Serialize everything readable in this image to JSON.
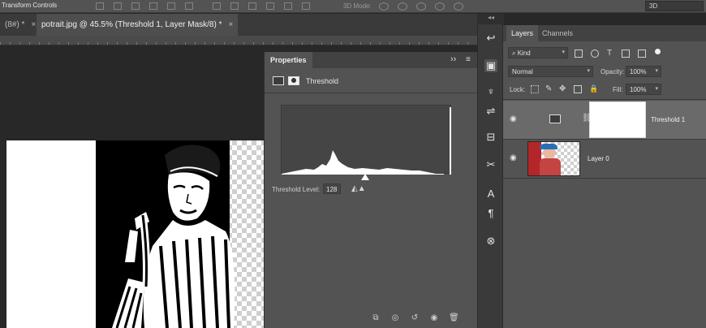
{
  "options_bar": {
    "transform_label": "Transform Controls",
    "mode_label": "3D Mode:",
    "workspace": "3D"
  },
  "tabs": [
    {
      "label": "(8#) *",
      "active": false
    },
    {
      "label": "potrait.jpg @ 45.5% (Threshold 1, Layer Mask/8) *",
      "active": true
    }
  ],
  "properties": {
    "title": "Properties",
    "adjustment_name": "Threshold",
    "threshold_level_label": "Threshold Level:",
    "threshold_level_value": "128",
    "collapse_icon": "collapse-icon",
    "menu_icon": "panel-menu-icon",
    "footer_icons": [
      "clip-to-layer-icon",
      "view-previous-icon",
      "reset-icon",
      "visibility-icon",
      "delete-icon"
    ]
  },
  "layers_panel": {
    "tabs": [
      "Layers",
      "Channels"
    ],
    "filter_kind": "Kind",
    "blend_mode": "Normal",
    "opacity_label": "Opacity:",
    "opacity_value": "100%",
    "lock_label": "Lock:",
    "fill_label": "Fill:",
    "fill_value": "100%",
    "layers": [
      {
        "name": "Threshold 1",
        "selected": true,
        "visible": true
      },
      {
        "name": "Layer 0",
        "selected": false,
        "visible": true
      }
    ]
  },
  "colors": {
    "panel_bg": "#535353",
    "dark_bg": "#282828",
    "selected_layer": "#6a6a6a"
  }
}
